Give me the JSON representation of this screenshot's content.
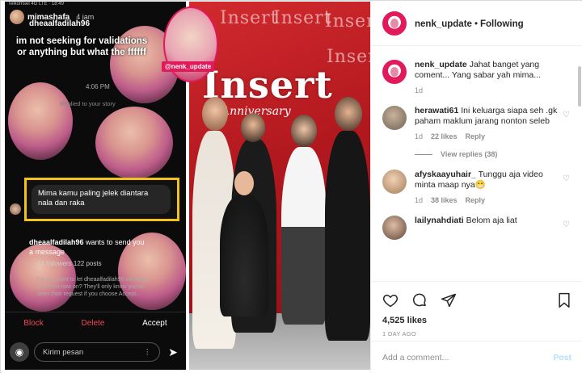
{
  "story": {
    "status_bar": "Telkomsel 4G LTE · 18:49",
    "username": "mimashafa",
    "time": "4 jam",
    "sender": "dheaalfadilah96",
    "caption": "im not seeking for validations or anything but what the ffffff",
    "timestamp": "4:06 PM",
    "replied_label": "Replied to your story",
    "message": "Mima kamu paling jelek diantara nala dan raka",
    "request_user": "dheaalfadilah96",
    "request_text": "wants to send you a message",
    "request_stats": "44 followers 122 posts",
    "request_note": "Do you want to let dheaalfadilah96 message you from now on? They'll only know you've seen their request if you choose Accept.",
    "action_block": "Block",
    "action_delete": "Delete",
    "action_accept": "Accept",
    "composer_placeholder": "Kirim pesan"
  },
  "photo": {
    "brand": "Insert",
    "brand_sub": "Anniversary",
    "sticker_tag": "@nenk_update"
  },
  "post": {
    "account": "nenk_update",
    "separator": "•",
    "follow_state": "Following",
    "likes": "4,525 likes",
    "date": "1 DAY AGO",
    "add_comment_placeholder": "Add a comment...",
    "post_label": "Post"
  },
  "comments": [
    {
      "user": "nenk_update",
      "text": "Jahat banget yang coment... Yang sabar yah mima...",
      "age": "1d",
      "likes": "",
      "reply": ""
    },
    {
      "user": "herawati61",
      "text": "Ini keluarga siapa seh .gk paham maklum jarang nonton seleb",
      "age": "1d",
      "likes": "22 likes",
      "reply": "Reply"
    },
    {
      "user": "afyskaayuhair_",
      "text": "Tunggu aja video minta maap nya😁",
      "age": "1d",
      "likes": "38 likes",
      "reply": "Reply"
    },
    {
      "user": "lailynahdiati",
      "text": "Belom aja liat",
      "age": "",
      "likes": "",
      "reply": ""
    }
  ],
  "view_replies": "View replies (38)",
  "icons": [
    "heart-icon",
    "comment-icon",
    "share-icon",
    "bookmark-icon",
    "camera-icon",
    "send-icon",
    "more-icon"
  ],
  "colors": {
    "brand_pink": "#e11a5b",
    "highlight": "#f5c21b",
    "danger": "#ed4956",
    "link_disabled": "#b2dffc"
  }
}
